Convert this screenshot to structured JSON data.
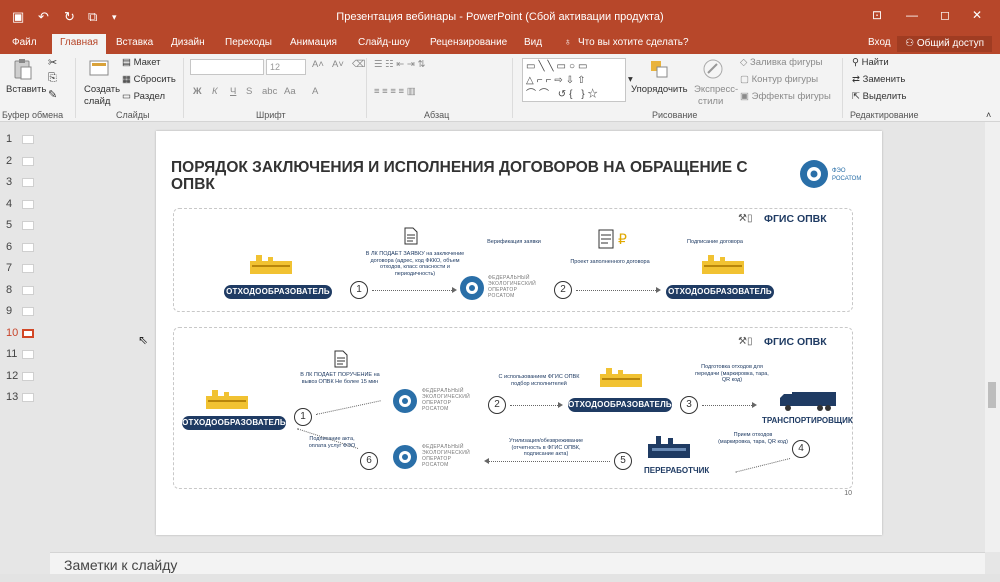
{
  "window": {
    "title": "Презентация вебинары - PowerPoint (Сбой активации продукта)"
  },
  "tabs": [
    {
      "label": "Файл"
    },
    {
      "label": "Главная",
      "active": true
    },
    {
      "label": "Вставка"
    },
    {
      "label": "Дизайн"
    },
    {
      "label": "Переходы"
    },
    {
      "label": "Анимация"
    },
    {
      "label": "Слайд-шоу"
    },
    {
      "label": "Рецензирование"
    },
    {
      "label": "Вид"
    }
  ],
  "tell_me": "Что вы хотите сделать?",
  "sign_in": "Вход",
  "share": "Общий доступ",
  "ribbon": {
    "clipboard": {
      "paste": "Вставить",
      "label": "Буфер обмена"
    },
    "slides": {
      "create": "Создать",
      "slide": "слайд",
      "layout": "Макет",
      "reset": "Сбросить",
      "section": "Раздел",
      "label": "Слайды"
    },
    "font": {
      "size": "12",
      "bold": "Ж",
      "italic": "К",
      "underline": "Ч",
      "strike": "S",
      "label": "Шрифт"
    },
    "paragraph": {
      "label": "Абзац"
    },
    "drawing": {
      "arrange": "Упорядочить",
      "express1": "Экспресс-",
      "express2": "стили",
      "fill": "Заливка фигуры",
      "outline": "Контур фигуры",
      "effects": "Эффекты фигуры",
      "label": "Рисование"
    },
    "editing": {
      "find": "Найти",
      "replace": "Заменить",
      "select": "Выделить",
      "label": "Редактирование"
    }
  },
  "thumbnails": [
    "1",
    "2",
    "3",
    "4",
    "5",
    "6",
    "7",
    "8",
    "9",
    "10",
    "11",
    "12",
    "13"
  ],
  "selected_slide": "10",
  "slide": {
    "title": "ПОРЯДОК ЗАКЛЮЧЕНИЯ И ИСПОЛНЕНИЯ ДОГОВОРОВ НА ОБРАЩЕНИЕ С ОПВК",
    "brand_text1": "ФЭО",
    "brand_text2": "РОСАТОМ",
    "page_number": "10",
    "fgis": "ФГИС ОПВК",
    "top": {
      "producer": "ОТХОДООБРАЗОВАТЕЛЬ",
      "producer2": "ОТХОДООБРАЗОВАТЕЛЬ",
      "note_request": "В ЛК ПОДАЕТ ЗАЯВКУ на заключение договора (адрес, код ФККО, объем отходов, класс опасности и периодичность)",
      "note_verify": "Верификация заявки",
      "note_project": "Проект заполненного договора",
      "note_sign": "Подписание договора",
      "step1": "1",
      "step2": "2",
      "org1": "ФЕДЕРАЛЬНЫЙ",
      "org2": "ЭКОЛОГИЧЕСКИЙ",
      "org3": "ОПЕРАТОР",
      "org4": "РОСАТОМ"
    },
    "bottom": {
      "producer": "ОТХОДООБРАЗОВАТЕЛЬ",
      "producer_mid": "ОТХОДООБРАЗОВАТЕЛЬ",
      "transporter": "ТРАНСПОРТИРОВЩИК",
      "processor": "ПЕРЕРАБОТЧИК",
      "note_order": "В ЛК ПОДАЕТ ПОРУЧЕНИЕ на вывоз ОПВК Не более 15 мин",
      "note_select": "С использованием ФГИС ОПВК подбор исполнителей",
      "note_prepare": "Подготовка отходов для передачи (маркировка, тара, QR код)",
      "note_accept": "Прием отходов (маркировка, тара, QR код)",
      "note_utilize": "Утилизация/обезвреживание (отчетность в ФГИС ОПВК, подписание акта)",
      "note_pay": "Подписание акта, оплата услуг ФЭО",
      "steps": [
        "1",
        "2",
        "3",
        "4",
        "5",
        "6"
      ]
    }
  },
  "notes_placeholder": "Заметки к слайду"
}
